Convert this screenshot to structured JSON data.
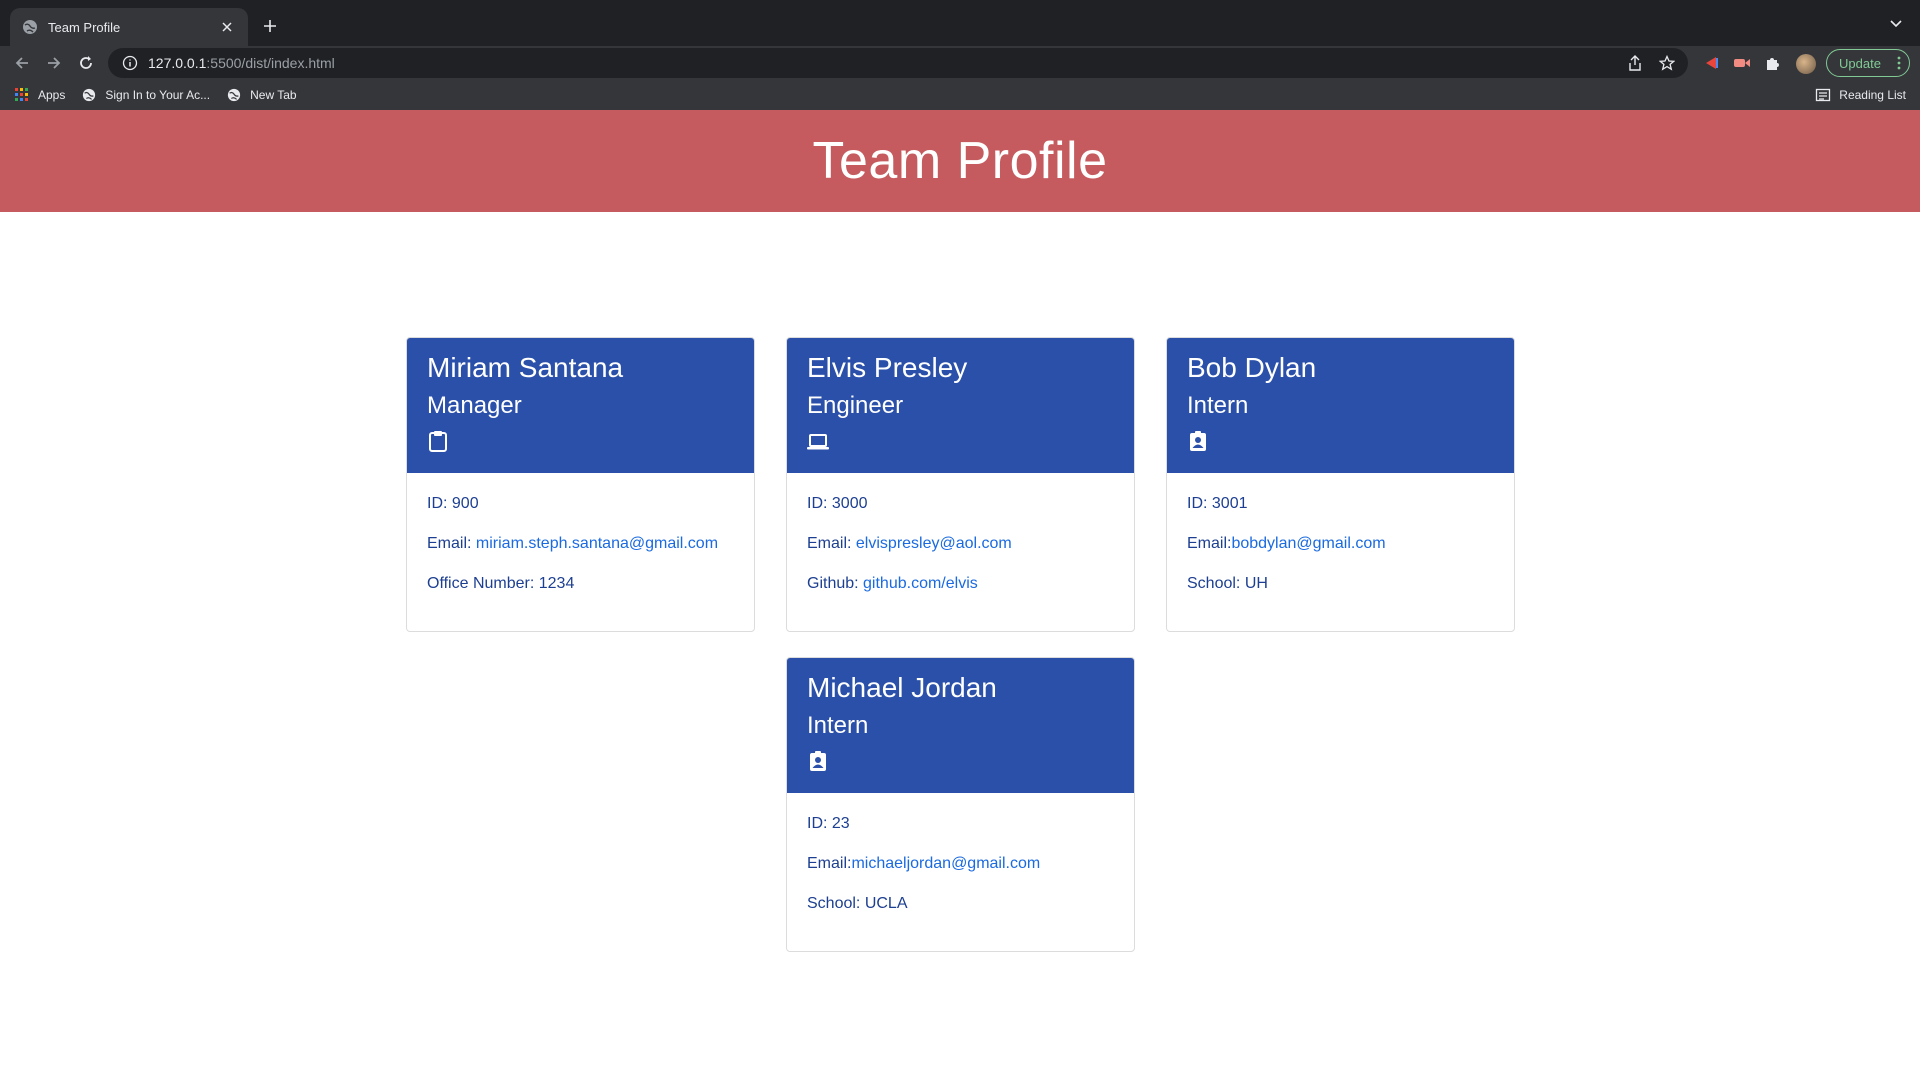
{
  "browser": {
    "tab_title": "Team Profile",
    "url_host": "127.0.0.1",
    "url_rest": ":5500/dist/index.html",
    "update_label": "Update",
    "bookmarks": [
      "Apps",
      "Sign In to Your Ac...",
      "New Tab"
    ],
    "reading_list": "Reading List"
  },
  "header": {
    "title": "Team Profile"
  },
  "team": [
    {
      "name": "Miriam Santana",
      "role": "Manager",
      "icon": "clipboard-icon",
      "id_label": "ID: 900",
      "email_label": "Email: ",
      "email": "miriam.steph.santana@gmail.com",
      "extra_label": "Office Number: 1234",
      "extra_link": ""
    },
    {
      "name": "Elvis Presley",
      "role": "Engineer",
      "icon": "laptop-icon",
      "id_label": "ID: 3000",
      "email_label": "Email: ",
      "email": "elvispresley@aol.com",
      "extra_label": "Github: ",
      "extra_link": "github.com/elvis"
    },
    {
      "name": "Bob Dylan",
      "role": "Intern",
      "icon": "id-badge-icon",
      "id_label": "ID: 3001",
      "email_label": "Email:",
      "email": "bobdylan@gmail.com",
      "extra_label": "School: UH",
      "extra_link": ""
    },
    {
      "name": "Michael Jordan",
      "role": "Intern",
      "icon": "id-badge-icon",
      "id_label": "ID: 23",
      "email_label": "Email:",
      "email": "michaeljordan@gmail.com",
      "extra_label": "School: UCLA",
      "extra_link": ""
    }
  ],
  "colors": {
    "banner": "#c55b5f",
    "card_header": "#2b50aa",
    "link": "#1a6ae0",
    "body_text": "#1d3f91"
  }
}
